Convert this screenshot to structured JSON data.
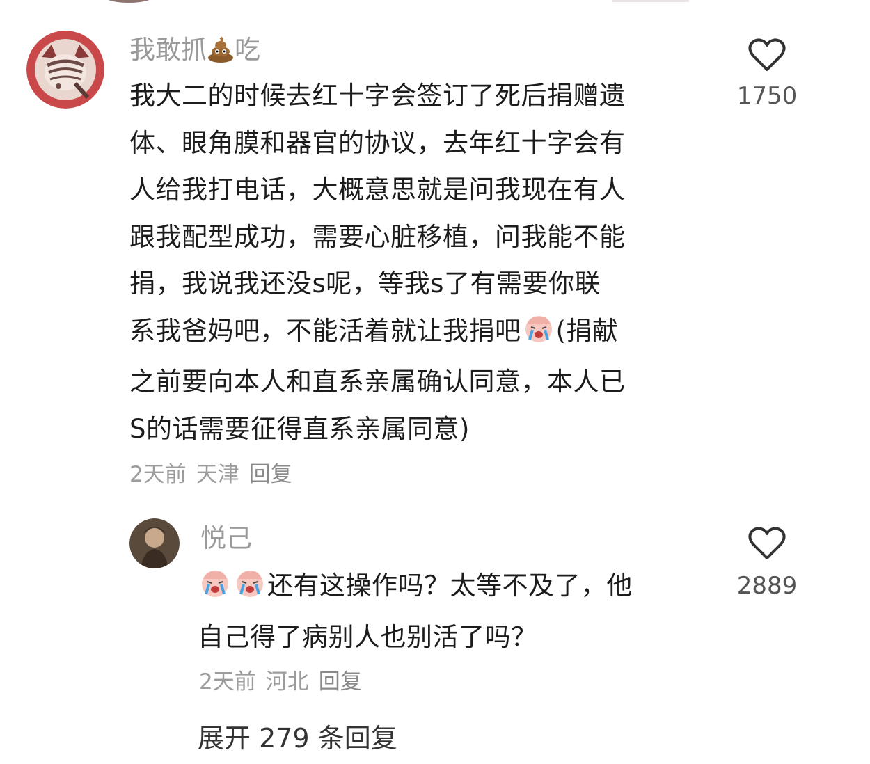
{
  "comments": [
    {
      "username": "我敢抓",
      "username_suffix": "吃",
      "username_emoji": "poop-emoji",
      "lines": [
        "我大二的时候去红十字会签订了死后捐赠遗",
        "体、眼角膜和器官的协议，去年红十字会有",
        "人给我打电话，大概意思就是问我现在有人",
        "跟我配型成功，需要心脏移植，问我能不能",
        "捐，我说我还没s呢，等我s了有需要你联",
        "系我爸妈吧，不能活着就让我捐吧",
        "之前要向本人和直系亲属确认同意，本人已",
        "S的话需要征得直系亲属同意)"
      ],
      "line6_after_emoji": "(捐献",
      "inline_emoji": "crying-emoji",
      "time": "2天前",
      "location": "天津",
      "reply_label": "回复",
      "like_icon": "heart-outline-icon",
      "likes": "1750"
    },
    {
      "username": "悦己",
      "lines": [
        "还有这操作吗？太等不及了，他",
        "自己得了病别人也别活了吗？"
      ],
      "leading_emojis": [
        "crying-emoji",
        "crying-emoji"
      ],
      "time": "2天前",
      "location": "河北",
      "reply_label": "回复",
      "like_icon": "heart-outline-icon",
      "likes": "2889"
    }
  ],
  "expand_replies": "展开 279 条回复",
  "colors": {
    "username": "#9a9a9a",
    "body": "#1c1c1c",
    "meta": "#9c9c9c"
  }
}
